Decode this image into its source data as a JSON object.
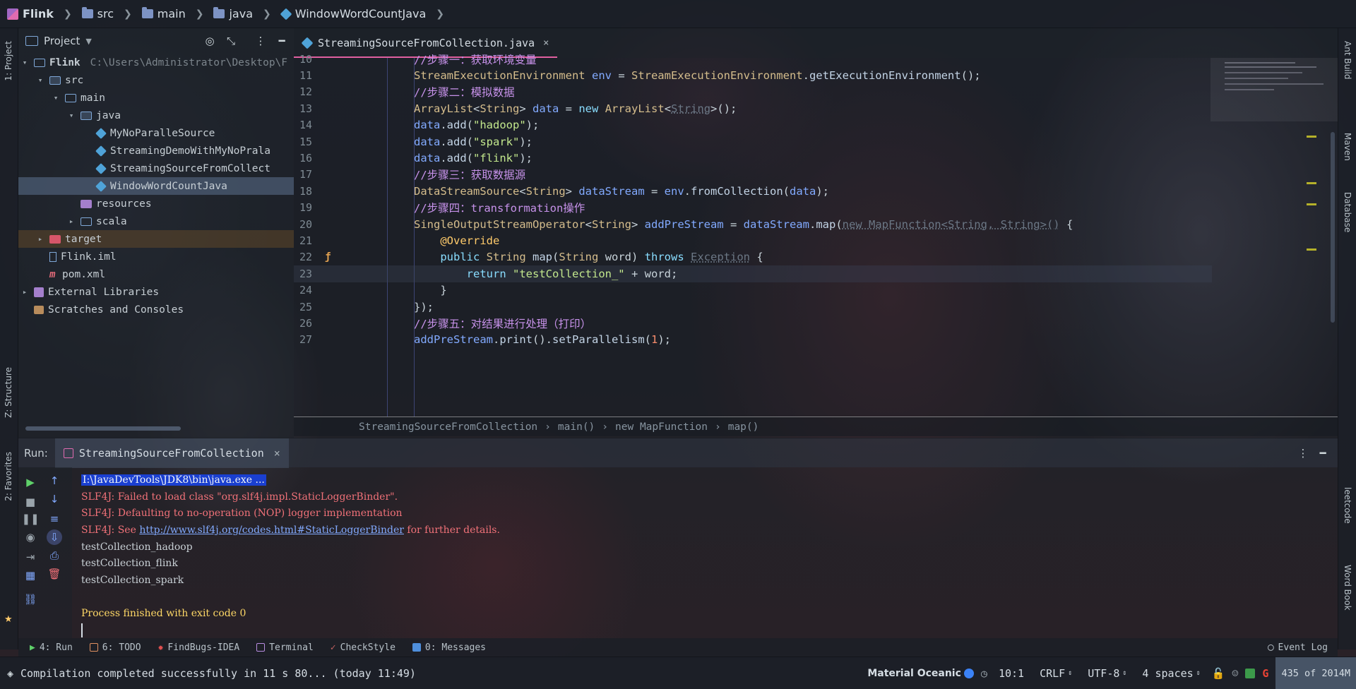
{
  "navbar": {
    "crumbs": [
      "Flink",
      "src",
      "main",
      "java",
      "WindowWordCountJava"
    ]
  },
  "left_stripe": {
    "project": "1: Project",
    "structure": "Z: Structure",
    "favorites": "2: Favorites"
  },
  "right_stripe": {
    "ant": "Ant Build",
    "maven": "Maven",
    "database": "Database",
    "leetcode": "leetcode",
    "wordbook": "Word Book"
  },
  "project_panel": {
    "title": "Project",
    "tree": [
      {
        "label": "Flink",
        "extra": "C:\\Users\\Administrator\\Desktop\\F",
        "indent": 0,
        "arrow": "▾",
        "icon": "folder-blue"
      },
      {
        "label": "src",
        "indent": 1,
        "arrow": "▾",
        "icon": "folder-src"
      },
      {
        "label": "main",
        "indent": 2,
        "arrow": "▾",
        "icon": "folder-blue"
      },
      {
        "label": "java",
        "indent": 3,
        "arrow": "▾",
        "icon": "folder-src"
      },
      {
        "label": "MyNoParalleSource",
        "indent": 4,
        "arrow": "",
        "icon": "java"
      },
      {
        "label": "StreamingDemoWithMyNoPrala",
        "indent": 4,
        "arrow": "",
        "icon": "java"
      },
      {
        "label": "StreamingSourceFromCollect",
        "indent": 4,
        "arrow": "",
        "icon": "java"
      },
      {
        "label": "WindowWordCountJava",
        "indent": 4,
        "arrow": "",
        "icon": "java",
        "selected": true
      },
      {
        "label": "resources",
        "indent": 3,
        "arrow": "",
        "icon": "folder-res"
      },
      {
        "label": "scala",
        "indent": 3,
        "arrow": "▸",
        "icon": "folder-blue"
      },
      {
        "label": "target",
        "indent": 1,
        "arrow": "▸",
        "icon": "folder-target",
        "excluded": true
      },
      {
        "label": "Flink.iml",
        "indent": 1,
        "arrow": "",
        "icon": "iml"
      },
      {
        "label": "pom.xml",
        "indent": 1,
        "arrow": "",
        "icon": "maven"
      },
      {
        "label": "External Libraries",
        "indent": 0,
        "arrow": "▸",
        "icon": "lib"
      },
      {
        "label": "Scratches and Consoles",
        "indent": 0,
        "arrow": "",
        "icon": "scratch"
      }
    ]
  },
  "editor": {
    "tab": "StreamingSourceFromCollection.java",
    "lines": [
      {
        "n": "10",
        "tokens": [
          [
            "cm",
            "//步骤一：获取环境变量"
          ]
        ]
      },
      {
        "n": "11",
        "tokens": [
          [
            "ty",
            "StreamExecutionEnvironment"
          ],
          [
            "plain",
            " "
          ],
          [
            "var",
            "env"
          ],
          [
            "plain",
            " = "
          ],
          [
            "ty",
            "StreamExecutionEnvironment"
          ],
          [
            "plain",
            "."
          ],
          [
            "fn",
            "getExecutionEnvironment"
          ],
          [
            "plain",
            "();"
          ]
        ]
      },
      {
        "n": "12",
        "tokens": [
          [
            "cm",
            "//步骤二：模拟数据"
          ]
        ]
      },
      {
        "n": "13",
        "tokens": [
          [
            "ty",
            "ArrayList"
          ],
          [
            "plain",
            "<"
          ],
          [
            "ty",
            "String"
          ],
          [
            "plain",
            "> "
          ],
          [
            "var",
            "data"
          ],
          [
            "plain",
            " = "
          ],
          [
            "kw",
            "new"
          ],
          [
            "plain",
            " "
          ],
          [
            "ty",
            "ArrayList"
          ],
          [
            "plain",
            "<"
          ],
          [
            "dim",
            "String"
          ],
          [
            "plain",
            ">();"
          ]
        ]
      },
      {
        "n": "14",
        "tokens": [
          [
            "var",
            "data"
          ],
          [
            "plain",
            "."
          ],
          [
            "fn",
            "add"
          ],
          [
            "plain",
            "("
          ],
          [
            "str",
            "\"hadoop\""
          ],
          [
            "plain",
            ");"
          ]
        ]
      },
      {
        "n": "15",
        "tokens": [
          [
            "var",
            "data"
          ],
          [
            "plain",
            "."
          ],
          [
            "fn",
            "add"
          ],
          [
            "plain",
            "("
          ],
          [
            "str",
            "\"spark\""
          ],
          [
            "plain",
            ");"
          ]
        ]
      },
      {
        "n": "16",
        "tokens": [
          [
            "var",
            "data"
          ],
          [
            "plain",
            "."
          ],
          [
            "fn",
            "add"
          ],
          [
            "plain",
            "("
          ],
          [
            "str",
            "\"flink\""
          ],
          [
            "plain",
            ");"
          ]
        ]
      },
      {
        "n": "17",
        "tokens": [
          [
            "cm",
            "//步骤三：获取数据源"
          ]
        ]
      },
      {
        "n": "18",
        "tokens": [
          [
            "ty",
            "DataStreamSource"
          ],
          [
            "plain",
            "<"
          ],
          [
            "ty",
            "String"
          ],
          [
            "plain",
            "> "
          ],
          [
            "var",
            "dataStream"
          ],
          [
            "plain",
            " = "
          ],
          [
            "var",
            "env"
          ],
          [
            "plain",
            "."
          ],
          [
            "fn",
            "fromCollection"
          ],
          [
            "plain",
            "("
          ],
          [
            "var",
            "data"
          ],
          [
            "plain",
            ");"
          ]
        ]
      },
      {
        "n": "19",
        "tokens": [
          [
            "cm",
            "//步骤四：transformation操作"
          ]
        ]
      },
      {
        "n": "20",
        "tokens": [
          [
            "ty",
            "SingleOutputStreamOperator"
          ],
          [
            "plain",
            "<"
          ],
          [
            "ty",
            "String"
          ],
          [
            "plain",
            "> "
          ],
          [
            "var",
            "addPreStream"
          ],
          [
            "plain",
            " = "
          ],
          [
            "var",
            "dataStream"
          ],
          [
            "plain",
            "."
          ],
          [
            "fn",
            "map"
          ],
          [
            "plain",
            "("
          ],
          [
            "dim",
            "new MapFunction<String, String>()"
          ],
          [
            "plain",
            " {"
          ]
        ]
      },
      {
        "n": "21",
        "tokens": [
          [
            "plain",
            "    "
          ],
          [
            "ann",
            "@Override"
          ]
        ]
      },
      {
        "n": "22",
        "tokens": [
          [
            "plain",
            "    "
          ],
          [
            "kw",
            "public"
          ],
          [
            "plain",
            " "
          ],
          [
            "ty",
            "String"
          ],
          [
            "plain",
            " "
          ],
          [
            "fn",
            "map"
          ],
          [
            "plain",
            "("
          ],
          [
            "ty",
            "String"
          ],
          [
            "plain",
            " word) "
          ],
          [
            "kw",
            "throws"
          ],
          [
            "plain",
            " "
          ],
          [
            "dim",
            "Exception"
          ],
          [
            "plain",
            " {"
          ]
        ]
      },
      {
        "n": "23",
        "tokens": [
          [
            "plain",
            "        "
          ],
          [
            "kw",
            "return"
          ],
          [
            "plain",
            " "
          ],
          [
            "str",
            "\"testCollection_\""
          ],
          [
            "plain",
            " + word;"
          ]
        ],
        "current": true
      },
      {
        "n": "24",
        "tokens": [
          [
            "plain",
            "    }"
          ]
        ]
      },
      {
        "n": "25",
        "tokens": [
          [
            "plain",
            "});"
          ]
        ]
      },
      {
        "n": "26",
        "tokens": [
          [
            "cm",
            "//步骤五：对结果进行处理（打印）"
          ]
        ]
      },
      {
        "n": "27",
        "tokens": [
          [
            "var",
            "addPreStream"
          ],
          [
            "plain",
            "."
          ],
          [
            "fn",
            "print"
          ],
          [
            "plain",
            "()."
          ],
          [
            "fn",
            "setParallelism"
          ],
          [
            "plain",
            "("
          ],
          [
            "num",
            "1"
          ],
          [
            "plain",
            ");"
          ]
        ]
      }
    ],
    "breadcrumbs": [
      "StreamingSourceFromCollection",
      "main()",
      "new MapFunction",
      "map()"
    ]
  },
  "run": {
    "label": "Run:",
    "tab": "StreamingSourceFromCollection",
    "console": {
      "cmd": "I:\\JavaDevTools\\JDK8\\bin\\java.exe ...",
      "err1": "SLF4J: Failed to load class \"org.slf4j.impl.StaticLoggerBinder\".",
      "err2": "SLF4J: Defaulting to no-operation (NOP) logger implementation",
      "err3_pre": "SLF4J: See ",
      "err3_link": "http://www.slf4j.org/codes.html#StaticLoggerBinder",
      "err3_post": " for further details.",
      "out1": "testCollection_hadoop",
      "out2": "testCollection_flink",
      "out3": "testCollection_spark",
      "done": "Process finished with exit code 0"
    }
  },
  "bottom_tabs": {
    "run": "4: Run",
    "todo": "6: TODO",
    "findbugs": "FindBugs-IDEA",
    "terminal": "Terminal",
    "checkstyle": "CheckStyle",
    "messages": "0: Messages",
    "eventlog": "Event Log"
  },
  "status": {
    "message": "Compilation completed successfully in 11 s 80... (today 11:49)",
    "theme": "Material Oceanic",
    "position": "10:1",
    "line_sep": "CRLF",
    "encoding": "UTF-8",
    "indent": "4 spaces",
    "memory": "435 of 2014M"
  }
}
